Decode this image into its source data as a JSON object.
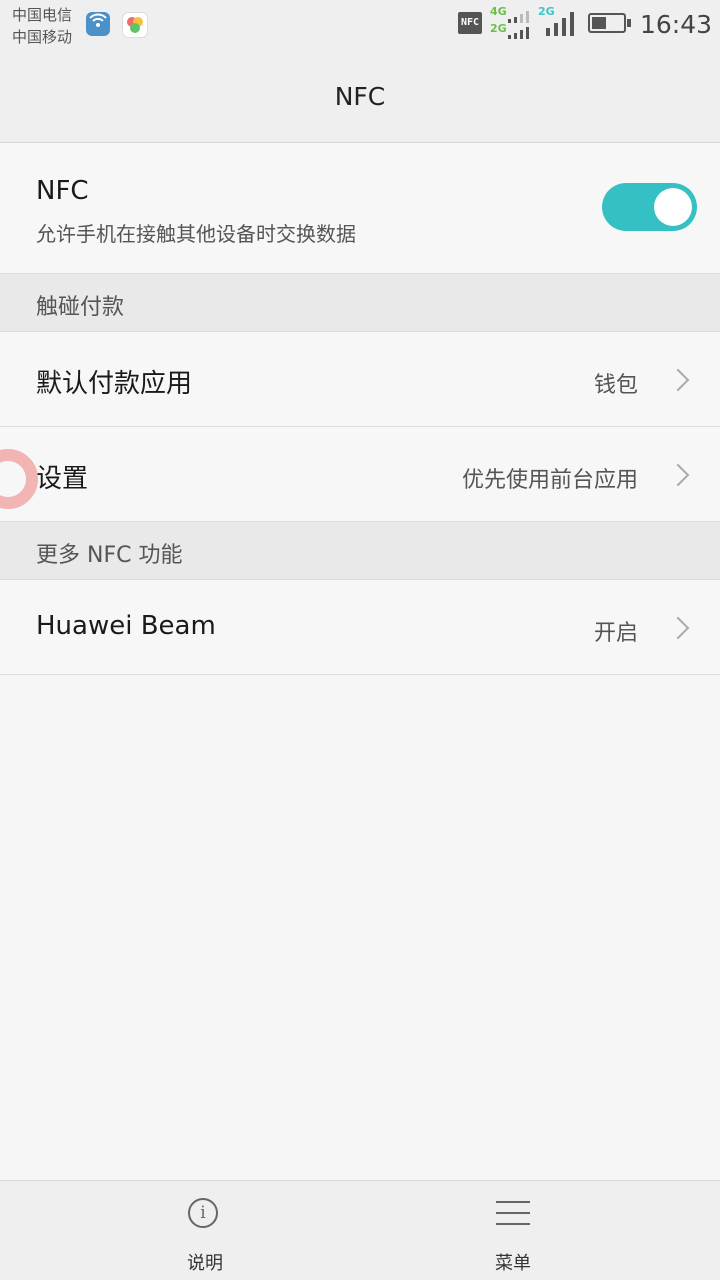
{
  "status_bar": {
    "carrier_1": "中国电信",
    "carrier_2": "中国移动",
    "nfc_badge": "NFC",
    "net_4g": "4G",
    "net_2g_a": "2G",
    "net_2g_b": "2G",
    "battery_level_percent": 45,
    "time": "16:43",
    "accent_4g": "#6cc04a",
    "accent_2g": "#3cc6c9"
  },
  "header": {
    "title": "NFC"
  },
  "nfc_toggle_row": {
    "title": "NFC",
    "subtitle": "允许手机在接触其他设备时交换数据",
    "enabled": true,
    "toggle_color": "#35c0c3"
  },
  "sections": {
    "tap_pay": {
      "header": "触碰付款",
      "items": [
        {
          "title": "默认付款应用",
          "value": "钱包"
        },
        {
          "title": "设置",
          "value": "优先使用前台应用"
        }
      ]
    },
    "more_nfc": {
      "header": "更多 NFC 功能",
      "items": [
        {
          "title": "Huawei Beam",
          "value": "开启"
        }
      ]
    }
  },
  "bottom_bar": {
    "help_label": "说明",
    "menu_label": "菜单"
  }
}
